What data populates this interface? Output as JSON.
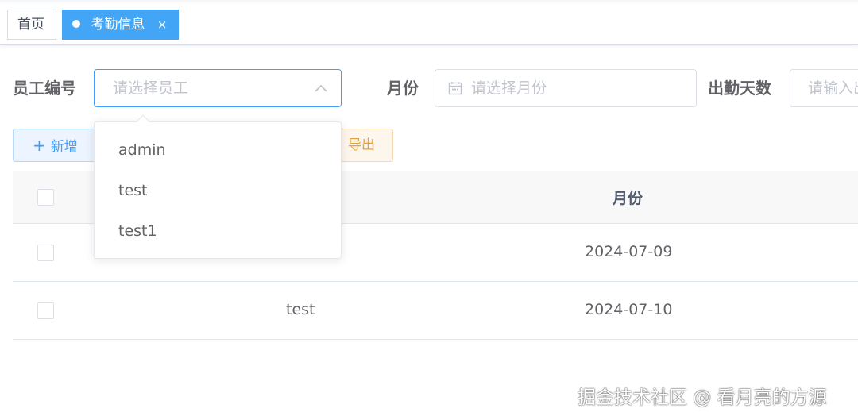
{
  "tags": {
    "home": "首页",
    "active": "考勤信息",
    "close": "×"
  },
  "search": {
    "employee_label": "员工编号",
    "employee_placeholder": "请选择员工",
    "month_label": "月份",
    "month_placeholder": "请选择月份",
    "days_label": "出勤天数",
    "days_placeholder": "请输入出勤天数"
  },
  "toolbar": {
    "add_label": "新增",
    "export_label": "导出"
  },
  "dropdown": {
    "options": [
      "admin",
      "test",
      "test1"
    ]
  },
  "table": {
    "month_header": "月份",
    "rows": [
      {
        "user": "",
        "month": "2024-07-09"
      },
      {
        "user": "test",
        "month": "2024-07-10"
      }
    ]
  },
  "watermark": "掘金技术社区 @ 看月亮的方源",
  "colors": {
    "primary": "#409eff",
    "tag_active": "#42a5f5",
    "warning": "#e6a23c"
  }
}
